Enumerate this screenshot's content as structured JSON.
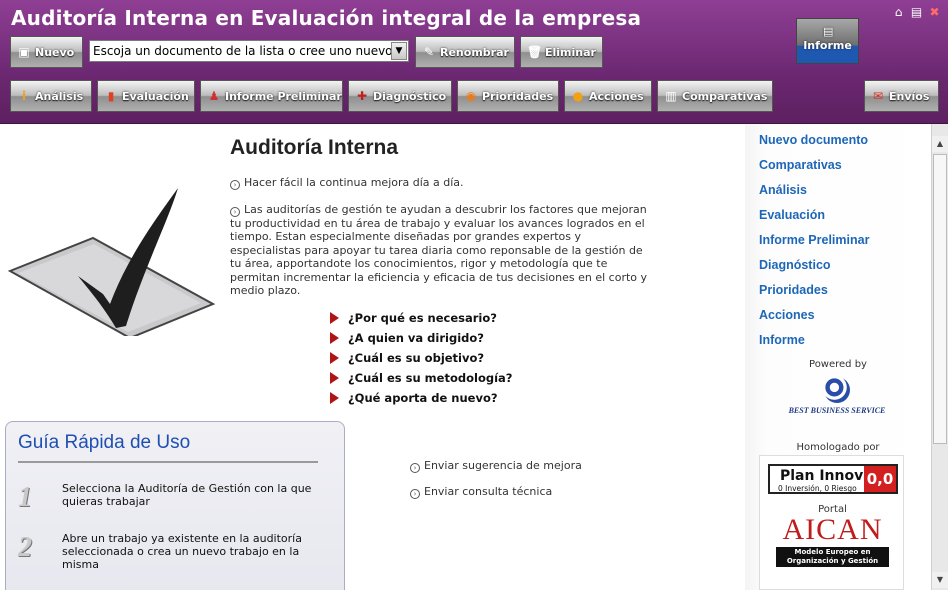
{
  "header": {
    "title": "Auditoría Interna en Evaluación integral de la empresa",
    "nuevo_label": "Nuevo",
    "document_select_value": "Escoja un documento de la lista o cree uno nuevo",
    "renombrar_label": "Renombrar",
    "eliminar_label": "Eliminar",
    "informe_big_label": "Informe",
    "nav": [
      {
        "label": "Análisis",
        "icon": "analysis-icon"
      },
      {
        "label": "Evaluación",
        "icon": "bar-chart-icon"
      },
      {
        "label": "Informe Preliminar",
        "icon": "report-person-icon"
      },
      {
        "label": "Diagnóstico",
        "icon": "diagnosis-icon"
      },
      {
        "label": "Prioridades",
        "icon": "priority-icon"
      },
      {
        "label": "Acciones",
        "icon": "lightbulb-icon"
      },
      {
        "label": "Comparativas",
        "icon": "compare-icon"
      }
    ],
    "envios_label": "Envíos",
    "colors": {
      "header_purple": "#7a3280",
      "accent_blue": "#1f58b0"
    }
  },
  "main": {
    "heading": "Auditoría Interna",
    "tagline": "Hacer fácil la continua mejora día a día.",
    "description": "Las auditorías de gestión te ayudan a descubrir los factores que mejoran tu productividad en tu área de trabajo y evaluar los avances logrados en el tiempo. Estan especialmente diseñadas por grandes expertos y especialistas para apoyar tu tarea diaria como reponsable de la gestión de tu área, apportandote los conocimientos, rigor y metodología que te permitan incrementar la eficiencia y eficacia de tus decisiones en el corto y medio plazo.",
    "questions": [
      "¿Por qué es necesario?",
      "¿A quien va dirigido?",
      "¿Cuál es su objetivo?",
      "¿Cuál es su metodología?",
      "¿Qué aporta de nuevo?"
    ],
    "links": [
      "Enviar sugerencia de mejora",
      "Enviar consulta técnica"
    ]
  },
  "guide": {
    "title": "Guía Rápida de Uso",
    "steps": [
      {
        "number": "1",
        "text": "Selecciona la Auditoría de Gestión con la que quieras trabajar"
      },
      {
        "number": "2",
        "text": "Abre un trabajo ya existente en la auditoría seleccionada o crea un nuevo trabajo en la misma"
      }
    ]
  },
  "sidebar": {
    "items": [
      "Nuevo documento",
      "Comparativas",
      "Análisis",
      "Evaluación",
      "Informe Preliminar",
      "Diagnóstico",
      "Prioridades",
      "Acciones",
      "Informe"
    ],
    "powered_by": "Powered by",
    "bbs_name": "BEST BUSINESS SERVICE",
    "homologado": "Homologado por",
    "plan_innova": {
      "title": "Plan Innova",
      "subtitle": "0 Inversión, 0 Riesgo",
      "score": "0,0"
    },
    "aican": {
      "portal": "Portal",
      "name": "AICAN",
      "tagline": "Modelo Europeo en Organización y Gestión"
    }
  }
}
